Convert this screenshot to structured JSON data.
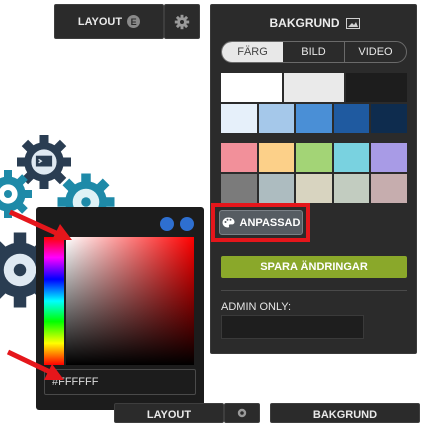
{
  "toolbar": {
    "layout_label": "LAYOUT",
    "layout_shortcut": "E",
    "settings_icon": "gear-icon"
  },
  "background_panel": {
    "title": "BAKGRUND",
    "title_icon": "image-icon",
    "tabs": [
      {
        "label": "FÄRG",
        "active": true
      },
      {
        "label": "BILD",
        "active": false
      },
      {
        "label": "VIDEO",
        "active": false
      }
    ],
    "palette_group_1": [
      [
        "#ffffff",
        "#eaeaea",
        "#1d1d1d"
      ],
      [
        "#e6f0fa",
        "#a5c8ea",
        "#4a8fd6",
        "#1f5aa0",
        "#0e2c4e"
      ]
    ],
    "palette_group_2": [
      [
        "#f2909a",
        "#fcd089",
        "#a3d476",
        "#79d2e0",
        "#a89be6"
      ],
      [
        "#7b7b7b",
        "#adbcc0",
        "#d8d4c0",
        "#c2ccc0",
        "#c6adae"
      ]
    ],
    "custom_button": {
      "label": "ANPASSAD",
      "icon": "palette-icon"
    },
    "save_button": "SPARA ÄNDRINGAR",
    "admin_label": "ADMIN ONLY:",
    "admin_input_value": ""
  },
  "color_picker": {
    "hex_value": "#FFFFFF",
    "swatch_colors": [
      "#2e6fd0",
      "#2e6fd0"
    ]
  },
  "bottom_bar": {
    "layout_label": "LAYOUT",
    "panel_title": "BAKGRUND"
  },
  "colors": {
    "highlight_red": "#e5161b",
    "save_green": "#8aa82a",
    "panel_dark": "#2b2b2b"
  }
}
